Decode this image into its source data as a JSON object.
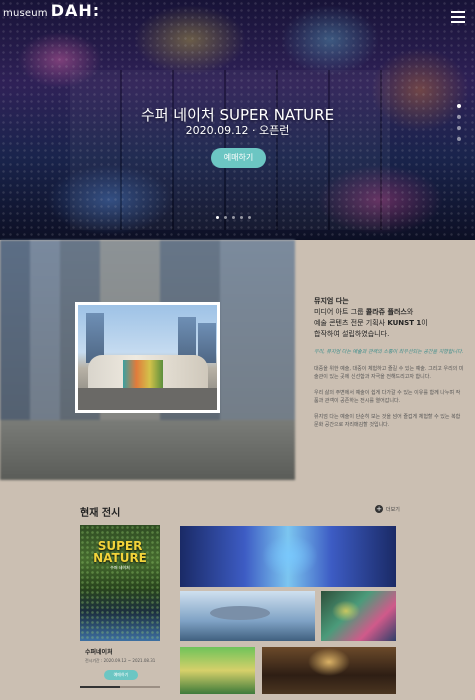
{
  "header": {
    "logo_small": "museum",
    "logo_big": "DAH:"
  },
  "hero": {
    "title": "수퍼 네이처 SUPER NATURE",
    "date": "2020.09.12 · 오픈런",
    "button": "예매하기"
  },
  "about": {
    "intro_1": "뮤지엄 다는",
    "intro_2": "미디어 아트 그룹 ",
    "intro_bold": "콜라쥬 플러스",
    "intro_3": "와",
    "intro_4": "예술 콘텐츠 전문 기획사 ",
    "intro_bold2": "KUNST 1",
    "intro_5": "이",
    "intro_6": "합작하여 설립하였습니다.",
    "quote": "우리, 뮤지엄 다는 예술과 관객의 소통이 최우선되는 공간을 지향합니다.",
    "para1": "대중을 위한 예술, 대중이 체험하고 즐길 수 있는 예술. 그리고 우리의 미술관이 있는 곳에 신선함과 자극을 전해드리고자 합니다.",
    "para2": "우리 삶의 주변에서 예술이 쉽게 다가갈 수 있는 이유를 함께 나누며 작품과 관객이 공존하는 전시를 열어갑니다.",
    "para3": "뮤지엄 다는 예술이 단순히 보는 것을 넘어 즐겁게 체험할 수 있는 복합 문화 공간으로 자리매김할 것입니다."
  },
  "current": {
    "title": "현재 전시",
    "more": "더보기",
    "poster_title_1": "SUPER",
    "poster_title_2": "NATURE",
    "poster_sub": "수퍼 네이처",
    "name": "수퍼네이처",
    "period": "전시기간 : 2020.09.12 ~ 2021.08.31",
    "button": "예매하기",
    "progress": 0.5
  },
  "colors": {
    "accent": "#6cc6c3",
    "background": "#cbbfb2"
  },
  "icons": {
    "menu": "hamburger-icon",
    "more": "plus-circle-icon"
  }
}
